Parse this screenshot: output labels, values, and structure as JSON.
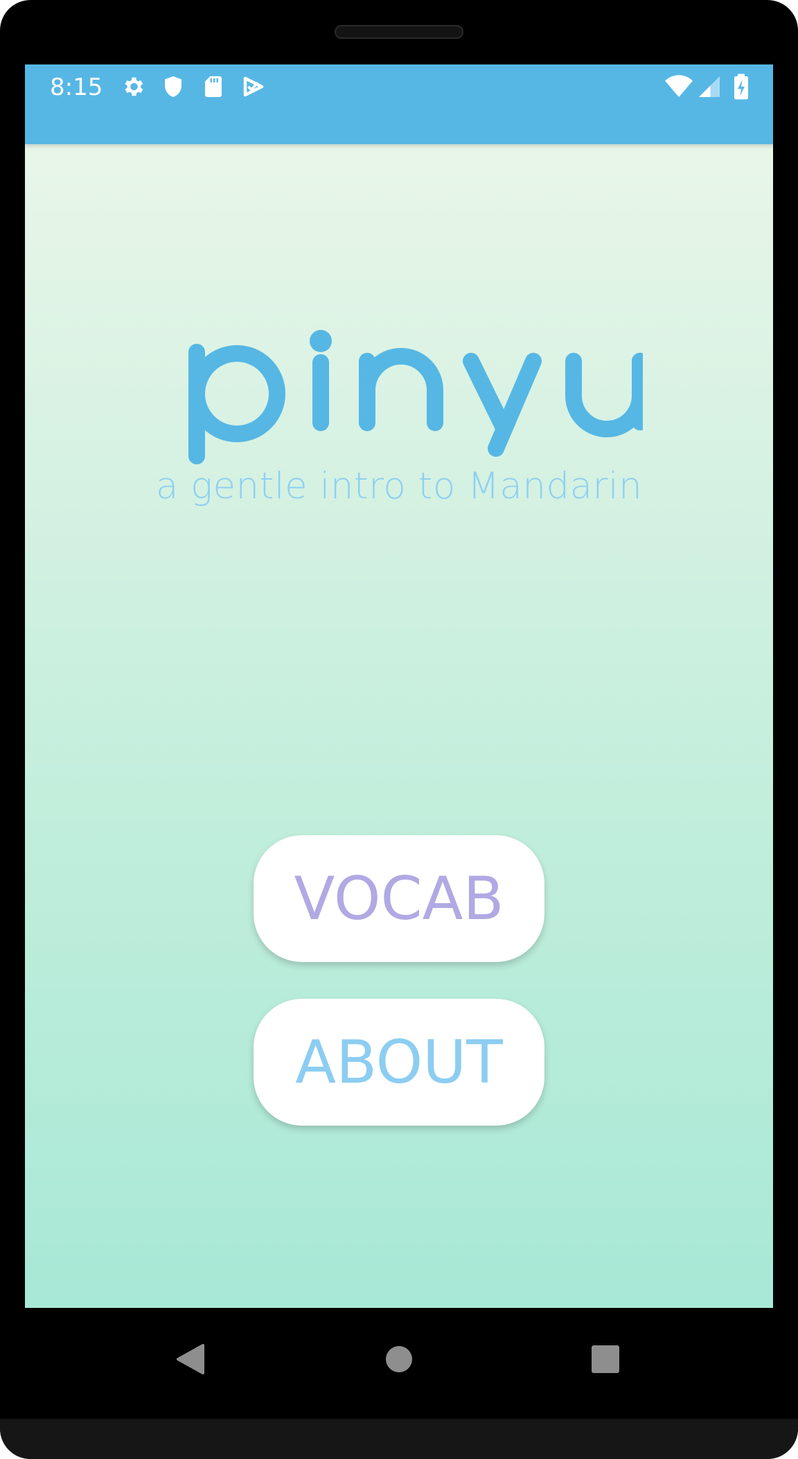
{
  "status_bar": {
    "time": "8:15",
    "left_icons": [
      "gear-icon",
      "shield-icon",
      "sd-card-icon",
      "task-check-icon"
    ],
    "right_icons": [
      "wifi-icon",
      "signal-icon",
      "battery-charging-icon"
    ],
    "background_color": "#56b7e4"
  },
  "app": {
    "logo_text": "pinyu",
    "logo_color": "#56b7e4",
    "tagline": "a gentle intro to Mandarin",
    "tagline_color": "#8fd0f1",
    "background_gradient": [
      "#edf7ea",
      "#a8e8d6"
    ]
  },
  "menu": {
    "vocab_label": "VOCAB",
    "vocab_color": "#b1a9e3",
    "about_label": "ABOUT",
    "about_color": "#8ccdf1"
  },
  "nav_bar": {
    "buttons": [
      "back-icon",
      "home-icon",
      "recents-icon"
    ]
  }
}
